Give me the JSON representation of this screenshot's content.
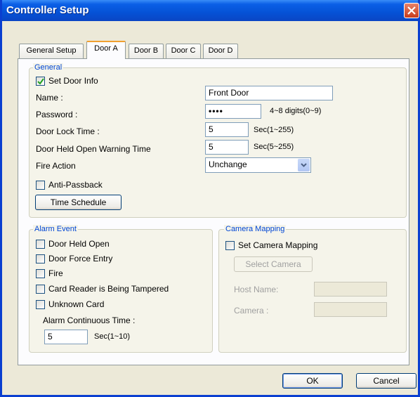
{
  "window": {
    "title": "Controller Setup"
  },
  "tabs": [
    {
      "label": "General Setup",
      "active": false
    },
    {
      "label": "Door A",
      "active": true
    },
    {
      "label": "Door B",
      "active": false
    },
    {
      "label": "Door C",
      "active": false
    },
    {
      "label": "Door D",
      "active": false
    }
  ],
  "general": {
    "legend": "General",
    "set_door_info": {
      "label": "Set Door Info",
      "checked": true
    },
    "name": {
      "label": "Name :",
      "value": "Front  Door"
    },
    "password": {
      "label": "Password :",
      "value": "••••",
      "hint": "4~8 digits(0~9)"
    },
    "lock_time": {
      "label": "Door Lock Time :",
      "value": "5",
      "unit": "Sec(1~255)"
    },
    "held_open": {
      "label": "Door Held Open Warning Time",
      "value": "5",
      "unit": "Sec(5~255)"
    },
    "fire_action": {
      "label": "Fire Action",
      "value": "Unchange"
    },
    "anti_passback": {
      "label": "Anti-Passback",
      "checked": false
    },
    "time_schedule_button": "Time Schedule"
  },
  "alarm": {
    "legend": "Alarm Event",
    "items": [
      {
        "label": "Door Held Open",
        "checked": false
      },
      {
        "label": "Door Force Entry",
        "checked": false
      },
      {
        "label": "Fire",
        "checked": false
      },
      {
        "label": "Card Reader is Being Tampered",
        "checked": false
      },
      {
        "label": "Unknown Card",
        "checked": false
      }
    ],
    "continuous_label": "Alarm Continuous Time :",
    "continuous_value": "5",
    "continuous_unit": "Sec(1~10)"
  },
  "camera": {
    "legend": "Camera Mapping",
    "set_camera": {
      "label": "Set Camera Mapping",
      "checked": false
    },
    "select_button": "Select Camera",
    "host_label": "Host Name:",
    "camera_label": "Camera :"
  },
  "footer": {
    "ok": "OK",
    "cancel": "Cancel"
  }
}
